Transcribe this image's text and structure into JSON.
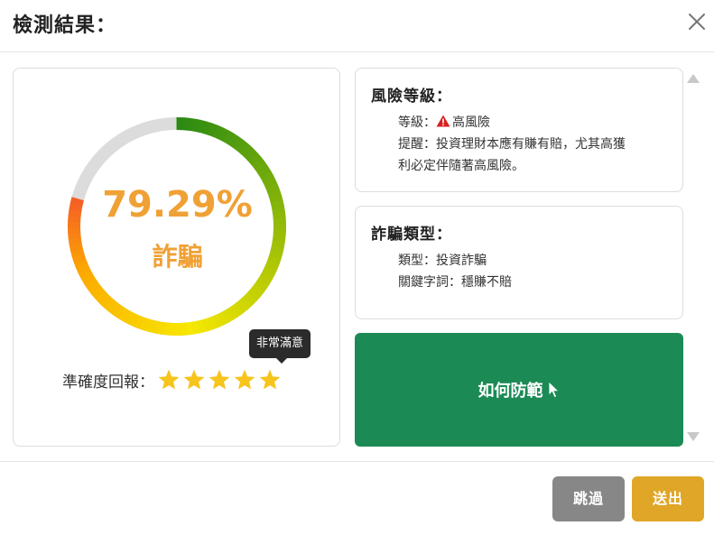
{
  "dialog": {
    "title": "檢測結果："
  },
  "result": {
    "percent_text": "79.29%",
    "verdict": "詐騙",
    "score_fraction": 0.7929,
    "rating_label": "準確度回報：",
    "rating_value": 5,
    "rating_max": 5,
    "rating_tooltip": "非常滿意"
  },
  "risk_card": {
    "title": "風險等級：",
    "level_prefix": "等級：",
    "level_value": "高風險",
    "reminder_line1": "提醒：投資理財本應有賺有賠，尤其高獲",
    "reminder_line2": "利必定伴隨著高風險。"
  },
  "type_card": {
    "title": "詐騙類型：",
    "type_line": "類型：投資詐騙",
    "keyword_line": "關鍵字詞：穩賺不賠"
  },
  "prevent_button": {
    "label": "如何防範"
  },
  "footer": {
    "skip_label": "跳過",
    "submit_label": "送出"
  },
  "icons": {
    "close": "close-icon",
    "warning": "warning-icon",
    "star": "star-icon",
    "cursor": "cursor-icon",
    "scroll_up": "triangle-up-icon",
    "scroll_down": "triangle-down-icon"
  },
  "colors": {
    "gauge_high": "#2a8a12",
    "gauge_mid": "#f7e800",
    "gauge_low": "#f55a28",
    "gauge_track": "#dcdcdc",
    "score_text": "#f0a135",
    "star": "#f6c41b",
    "prevent_button": "#1c8a55",
    "skip_button": "#878787",
    "submit_button": "#e0a627",
    "warning": "#d82020"
  }
}
